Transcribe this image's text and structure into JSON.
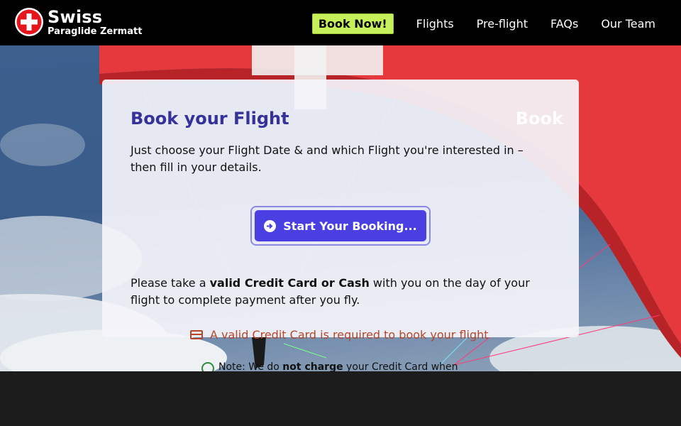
{
  "header": {
    "brand_title": "Swiss",
    "brand_subtitle": "Paraglide Zermatt",
    "book_now": "Book Now!",
    "nav": [
      "Flights",
      "Pre-flight",
      "FAQs",
      "Our Team"
    ]
  },
  "card": {
    "title": "Book your Flight",
    "watermark": "Book",
    "intro": "Just choose your Flight Date & and which Flight you're interested in – then fill in your details.",
    "start_button": "Start Your Booking...",
    "payment_prefix": "Please take a ",
    "payment_bold": "valid Credit Card or Cash",
    "payment_suffix": " with you on the day of your flight to complete payment after you fly."
  },
  "notes": {
    "credit_card": "A valid Credit Card is required to book your flight",
    "charge_prefix": "Note: We do ",
    "charge_bold": "not charge",
    "charge_suffix": " your Credit Card when"
  },
  "colors": {
    "accent": "#4a3fe0",
    "title": "#35329a",
    "book_now_bg": "#c5f05a",
    "warning": "#b5462b"
  },
  "icons": [
    "swiss-cross-icon",
    "arrow-right-circle-icon",
    "credit-card-icon",
    "check-circle-icon"
  ]
}
